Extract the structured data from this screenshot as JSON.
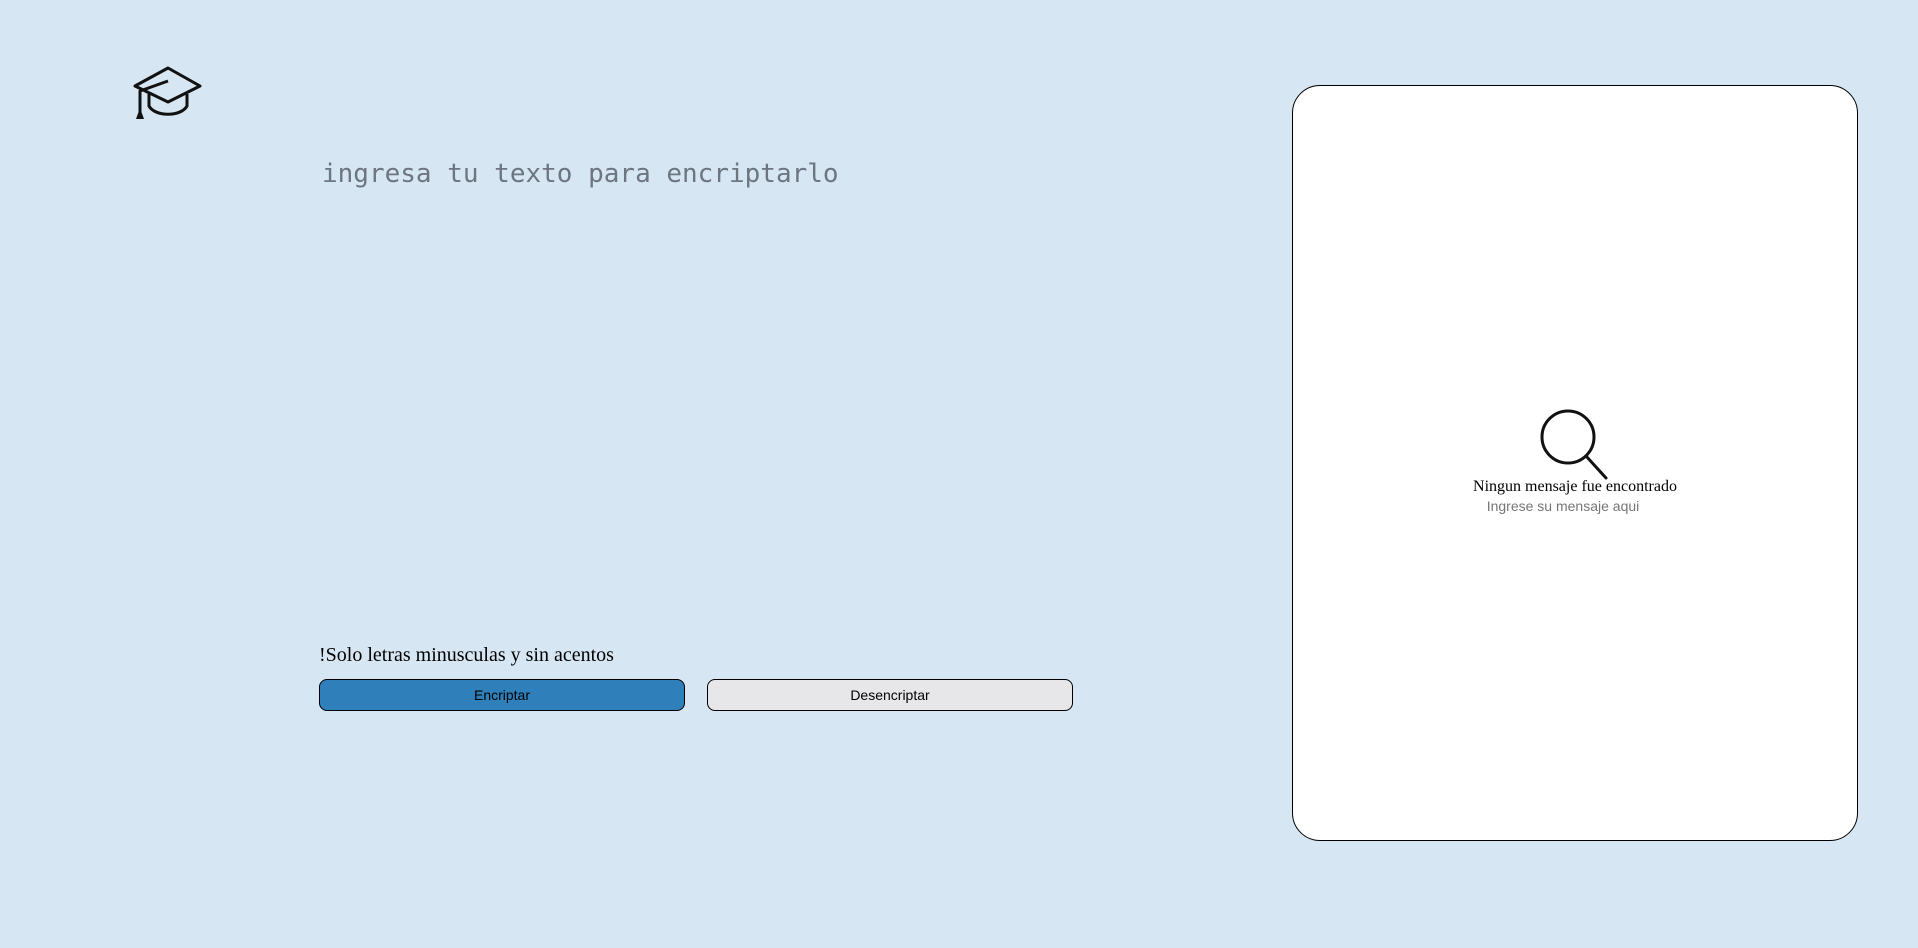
{
  "logo": {
    "icon": "graduation-cap-icon"
  },
  "editor": {
    "placeholder": "ingresa tu texto para encriptarlo",
    "value": ""
  },
  "warning": {
    "text": "!Solo letras minusculas y sin acentos"
  },
  "buttons": {
    "encrypt_label": "Encriptar",
    "decrypt_label": "Desencriptar"
  },
  "result": {
    "icon": "search-icon",
    "title": "Ningun mensaje fue encontrado",
    "subtitle": "Ingrese su mensaje aqui"
  },
  "colors": {
    "background": "#d6e6f3",
    "encrypt_button": "#2f7fba",
    "decrypt_button": "#e7e7ea",
    "panel": "#ffffff"
  }
}
